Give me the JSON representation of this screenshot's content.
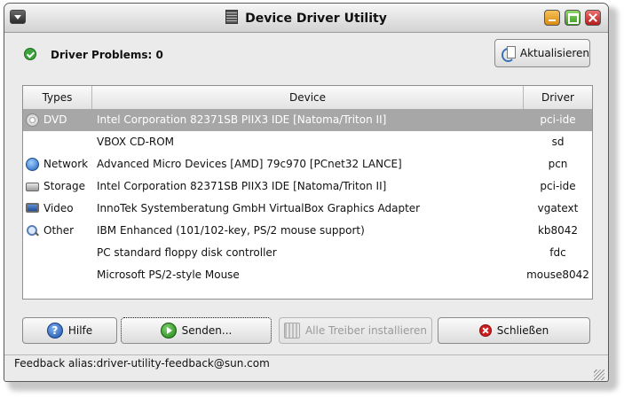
{
  "window": {
    "title": "Device Driver Utility"
  },
  "status": {
    "problems_text": "Driver Problems: 0"
  },
  "toolbar": {
    "refresh_label": "Aktualisieren"
  },
  "table": {
    "headers": {
      "types": "Types",
      "device": "Device",
      "driver": "Driver"
    },
    "rows": [
      {
        "type": "DVD",
        "icon": "dvd-icon",
        "device": "Intel Corporation 82371SB PIIX3 IDE [Natoma/Triton II]",
        "driver": "pci-ide",
        "selected": true
      },
      {
        "type": "",
        "icon": "",
        "device": "VBOX CD-ROM",
        "driver": "sd"
      },
      {
        "type": "Network",
        "icon": "network-globe-icon",
        "device": "Advanced Micro Devices [AMD] 79c970 [PCnet32 LANCE]",
        "driver": "pcn"
      },
      {
        "type": "Storage",
        "icon": "storage-drive-icon",
        "device": "Intel Corporation 82371SB PIIX3 IDE [Natoma/Triton II]",
        "driver": "pci-ide"
      },
      {
        "type": "Video",
        "icon": "video-monitor-icon",
        "device": "InnoTek Systemberatung GmbH VirtualBox Graphics Adapter",
        "driver": "vgatext"
      },
      {
        "type": "Other",
        "icon": "magnifier-icon",
        "device": "IBM Enhanced (101/102-key, PS/2 mouse support)",
        "driver": "kb8042"
      },
      {
        "type": "",
        "icon": "",
        "device": "PC standard floppy disk controller",
        "driver": "fdc"
      },
      {
        "type": "",
        "icon": "",
        "device": "Microsoft PS/2-style Mouse",
        "driver": "mouse8042"
      }
    ]
  },
  "buttons": {
    "help": "Hilfe",
    "send": "Senden...",
    "install_all": "Alle Treiber installieren",
    "close": "Schließen"
  },
  "statusbar": {
    "feedback": "Feedback alias:driver-utility-feedback@sun.com"
  }
}
